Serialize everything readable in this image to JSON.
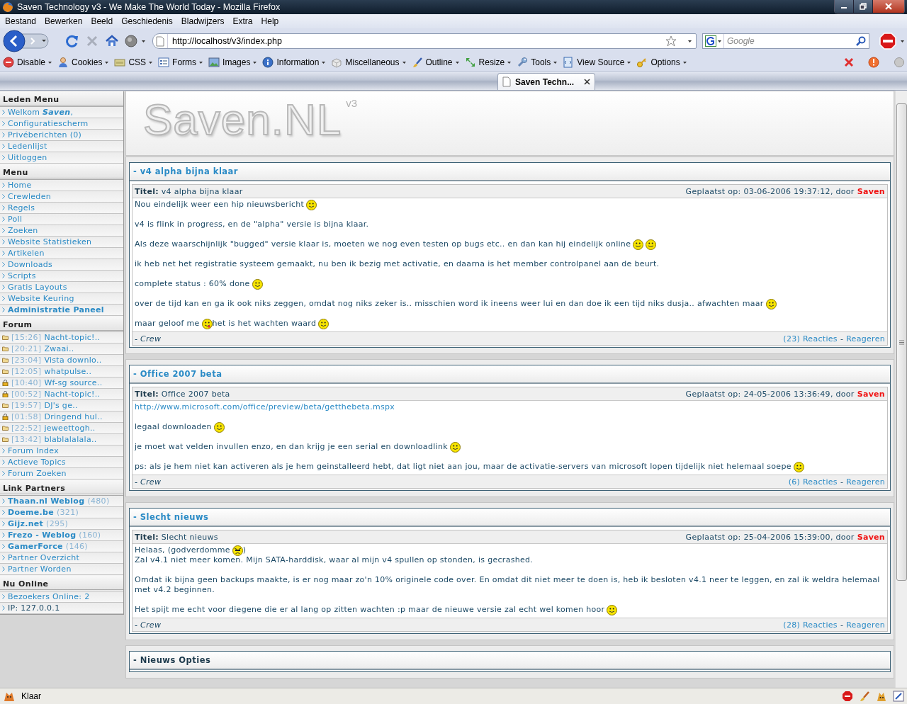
{
  "window": {
    "title": "Saven Technology v3 - We Make The World Today - Mozilla Firefox"
  },
  "menubar": [
    "Bestand",
    "Bewerken",
    "Beeld",
    "Geschiedenis",
    "Bladwijzers",
    "Extra",
    "Help"
  ],
  "navbar": {
    "url": "http://localhost/v3/index.php",
    "search_placeholder": "Google"
  },
  "toolbar": [
    "Disable",
    "Cookies",
    "CSS",
    "Forms",
    "Images",
    "Information",
    "Miscellaneous",
    "Outline",
    "Resize",
    "Tools",
    "View Source",
    "Options"
  ],
  "tabs": [
    {
      "label": "Saven Techn...",
      "selected": true
    }
  ],
  "sidebar": [
    {
      "title": "Leden Menu",
      "items": [
        {
          "kind": "link",
          "text": "Welkom **Saven**,"
        },
        {
          "kind": "link",
          "text": "Configuratiescherm"
        },
        {
          "kind": "link",
          "text": "Privéberichten (0)"
        },
        {
          "kind": "link",
          "text": "Ledenlijst"
        },
        {
          "kind": "link",
          "text": "Uitloggen"
        }
      ]
    },
    {
      "title": "Menu",
      "items": [
        {
          "kind": "link",
          "text": "Home"
        },
        {
          "kind": "link",
          "text": "Crewleden"
        },
        {
          "kind": "link",
          "text": "Regels"
        },
        {
          "kind": "link",
          "text": "Poll"
        },
        {
          "kind": "link",
          "text": "Zoeken"
        },
        {
          "kind": "link",
          "text": "Website Statistieken"
        },
        {
          "kind": "link",
          "text": "Artikelen"
        },
        {
          "kind": "link",
          "text": "Downloads"
        },
        {
          "kind": "link",
          "text": "Scripts"
        },
        {
          "kind": "link",
          "text": "Gratis Layouts"
        },
        {
          "kind": "link",
          "text": "Website Keuring"
        },
        {
          "kind": "link",
          "text": "Administratie Paneel",
          "bold": true
        }
      ]
    },
    {
      "title": "Forum",
      "items": [
        {
          "kind": "topic",
          "time": "[15:26]",
          "text": "Nacht-topic!..",
          "locked": false
        },
        {
          "kind": "topic",
          "time": "[20:21]",
          "text": "Zwaai..",
          "locked": false
        },
        {
          "kind": "topic",
          "time": "[23:04]",
          "text": "Vista downlo..",
          "locked": false
        },
        {
          "kind": "topic",
          "time": "[12:05]",
          "text": "whatpulse..",
          "locked": false
        },
        {
          "kind": "topic",
          "time": "[10:40]",
          "text": "Wf-sg source..",
          "locked": true
        },
        {
          "kind": "topic",
          "time": "[00:52]",
          "text": "Nacht-topic!..",
          "locked": true
        },
        {
          "kind": "topic",
          "time": "[19:57]",
          "text": "DJ's ge..",
          "locked": false
        },
        {
          "kind": "topic",
          "time": "[01:58]",
          "text": "Dringend hul..",
          "locked": true
        },
        {
          "kind": "topic",
          "time": "[22:52]",
          "text": "jeweettogh..",
          "locked": false
        },
        {
          "kind": "topic",
          "time": "[13:42]",
          "text": "blablalalala..",
          "locked": false
        },
        {
          "kind": "link",
          "text": "Forum Index"
        },
        {
          "kind": "link",
          "text": "Actieve Topics"
        },
        {
          "kind": "link",
          "text": "Forum Zoeken"
        }
      ]
    },
    {
      "title": "Link Partners",
      "items": [
        {
          "kind": "partner",
          "text": "Thaan.nl Weblog",
          "count": "(480)"
        },
        {
          "kind": "partner",
          "text": "Doeme.be",
          "count": "(321)"
        },
        {
          "kind": "partner",
          "text": "Gijz.net",
          "count": "(295)"
        },
        {
          "kind": "partner",
          "text": "Frezo - Weblog",
          "count": "(160)"
        },
        {
          "kind": "partner",
          "text": "GamerForce",
          "count": "(146)"
        },
        {
          "kind": "link",
          "text": "Partner Overzicht"
        },
        {
          "kind": "link",
          "text": "Partner Worden"
        }
      ]
    },
    {
      "title": "Nu Online",
      "items": [
        {
          "kind": "link",
          "text": "Bezoekers Online: 2"
        },
        {
          "kind": "plain",
          "text": "IP: 127.0.0.1"
        }
      ]
    }
  ],
  "logo": {
    "text": "Saven.NL",
    "version": "v3"
  },
  "posts": [
    {
      "heading": "- v4 alpha bijna klaar",
      "title": "**Titel:** v4 alpha bijna klaar",
      "posted": "Geplaatst op: 03-06-2006 19:37:12, door",
      "author": "Saven",
      "paragraphs": [
        [
          {
            "kind": "text",
            "text": "Nou eindelijk weer een hip nieuwsbericht"
          },
          {
            "kind": "smiley"
          }
        ],
        [
          {
            "kind": "text",
            "text": "v4 is flink in progress, en de \"alpha\" versie is bijna klaar."
          },
          {
            "kind": "break"
          }
        ],
        [
          {
            "kind": "text",
            "text": "Als deze waarschijnlijk \"bugged\" versie klaar is, moeten we nog even testen op bugs etc.. en dan kan hij eindelijk online"
          },
          {
            "kind": "smiley"
          },
          {
            "kind": "smiley"
          }
        ],
        [
          {
            "kind": "text",
            "text": "ik heb net het registratie systeem gemaakt, nu ben ik bezig met activatie, en daarna is het member controlpanel aan de beurt."
          }
        ],
        [
          {
            "kind": "text",
            "text": "complete status : 60% done"
          },
          {
            "kind": "smiley"
          }
        ],
        [
          {
            "kind": "text",
            "text": "over de tijd kan en ga ik ook niks zeggen, omdat nog niks zeker is.. misschien word ik ineens weer lui en dan doe ik een tijd niks dusja.. afwachten maar"
          },
          {
            "kind": "smiley"
          }
        ],
        [
          {
            "kind": "text",
            "text": "maar geloof me"
          },
          {
            "kind": "tongue"
          },
          {
            "kind": "text",
            "text": "het is het wachten waard"
          },
          {
            "kind": "smiley"
          }
        ]
      ],
      "footer": "- Crew",
      "reactions": "(23) Reacties",
      "separator": "-",
      "reply": "Reageren"
    },
    {
      "heading": "- Office 2007 beta",
      "title": "**Titel:** Office 2007 beta",
      "posted": "Geplaatst op: 24-05-2006 13:36:49, door",
      "author": "Saven",
      "paragraphs": [
        [
          {
            "kind": "link",
            "text": "http://www.microsoft.com/office/preview/beta/getthebeta.mspx"
          }
        ],
        [
          {
            "kind": "text",
            "text": "legaal downloaden"
          },
          {
            "kind": "smiley"
          }
        ],
        [
          {
            "kind": "text",
            "text": "je moet wat velden invullen enzo, en dan krijg je een serial en downloadlink"
          },
          {
            "kind": "smiley"
          }
        ],
        [
          {
            "kind": "text",
            "text": "ps: als je hem niet kan activeren als je hem geinstalleerd hebt, dat ligt niet aan jou, maar de activatie-servers van microsoft lopen tijdelijk niet helemaal soepe"
          },
          {
            "kind": "smiley"
          }
        ]
      ],
      "footer": "- Crew",
      "reactions": "(6) Reacties",
      "separator": "-",
      "reply": "Reageren"
    },
    {
      "heading": "- Slecht nieuws",
      "title": "**Titel:** Slecht nieuws",
      "posted": "Geplaatst op: 25-04-2006 15:39:00, door",
      "author": "Saven",
      "paragraphs": [
        [
          {
            "kind": "text",
            "text": "Helaas, (godverdomme"
          },
          {
            "kind": "angry"
          },
          {
            "kind": "text",
            "text": ")"
          },
          {
            "kind": "break"
          },
          {
            "kind": "text",
            "text": "Zal v4.1 niet meer komen. Mijn SATA-harddisk, waar al mijn v4 spullen op stonden, is gecrashed."
          }
        ],
        [
          {
            "kind": "text",
            "text": "Omdat ik bijna geen backups maakte, is er nog maar zo'n 10% originele code over. En omdat dit niet meer te doen is, heb ik besloten v4.1 neer te leggen, en zal ik weldra helemaal met v4.2 beginnen."
          }
        ],
        [
          {
            "kind": "text",
            "text": "Het spijt me echt voor diegene die er al lang op zitten wachten :p maar de nieuwe versie zal echt wel komen hoor"
          },
          {
            "kind": "smiley"
          }
        ]
      ],
      "footer": "- Crew",
      "reactions": "(28) Reacties",
      "separator": "-",
      "reply": "Reageren"
    }
  ],
  "options_panel": {
    "heading": "- Nieuws Opties"
  },
  "status_bar": {
    "text": "Klaar"
  }
}
